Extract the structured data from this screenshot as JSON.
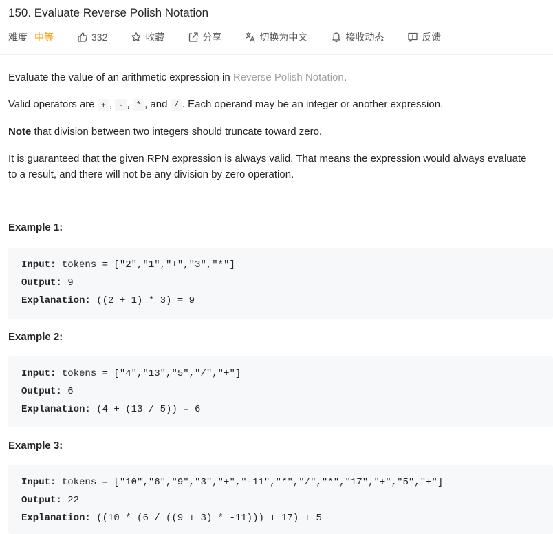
{
  "problem": {
    "title": "150. Evaluate Reverse Polish Notation",
    "difficulty_label": "难度",
    "difficulty": "中等",
    "likes": "332",
    "favorite_label": "收藏",
    "share_label": "分享",
    "translate_label": "切换为中文",
    "subscribe_label": "接收动态",
    "feedback_label": "反馈"
  },
  "description": {
    "p1_text": "Evaluate the value of an arithmetic expression in ",
    "p1_link": "Reverse Polish Notation",
    "p1_end": ".",
    "p2_start": "Valid operators are ",
    "op_plus": "+",
    "op_minus": "-",
    "op_times": "*",
    "op_div": "/",
    "comma": ",",
    "and_text": ", and",
    "p2_end": ". Each operand may be an integer or another expression.",
    "note_label": "Note",
    "note_text": " that division between two integers should truncate toward zero.",
    "p4": "It is guaranteed that the given RPN expression is always valid. That means the expression would always evaluate to a result, and there will not be any division by zero operation."
  },
  "labels": {
    "input": "Input:",
    "output": "Output:",
    "explanation": "Explanation:"
  },
  "examples": [
    {
      "heading": "Example 1:",
      "input": " tokens = [\"2\",\"1\",\"+\",\"3\",\"*\"]",
      "output": " 9",
      "explanation": " ((2 + 1) * 3) = 9"
    },
    {
      "heading": "Example 2:",
      "input": " tokens = [\"4\",\"13\",\"5\",\"/\",\"+\"]",
      "output": " 6",
      "explanation": " (4 + (13 / 5)) = 6"
    },
    {
      "heading": "Example 3:",
      "input": " tokens = [\"10\",\"6\",\"9\",\"3\",\"+\",\"-11\",\"*\",\"/\",\"*\",\"17\",\"+\",\"5\",\"+\"]",
      "output": " 22",
      "explanation": " ((10 * (6 / ((9 + 3) * -11))) + 17) + 5"
    }
  ],
  "colors": {
    "difficulty_medium": "#ff9900",
    "link": "#a0a0a0",
    "example_bg": "#f7f8fa",
    "meta_text": "#595959"
  },
  "icons": {
    "like": "thumbs-up-icon",
    "favorite": "star-icon",
    "share": "share-icon",
    "translate": "translate-icon",
    "subscribe": "bell-icon",
    "feedback": "feedback-icon"
  }
}
